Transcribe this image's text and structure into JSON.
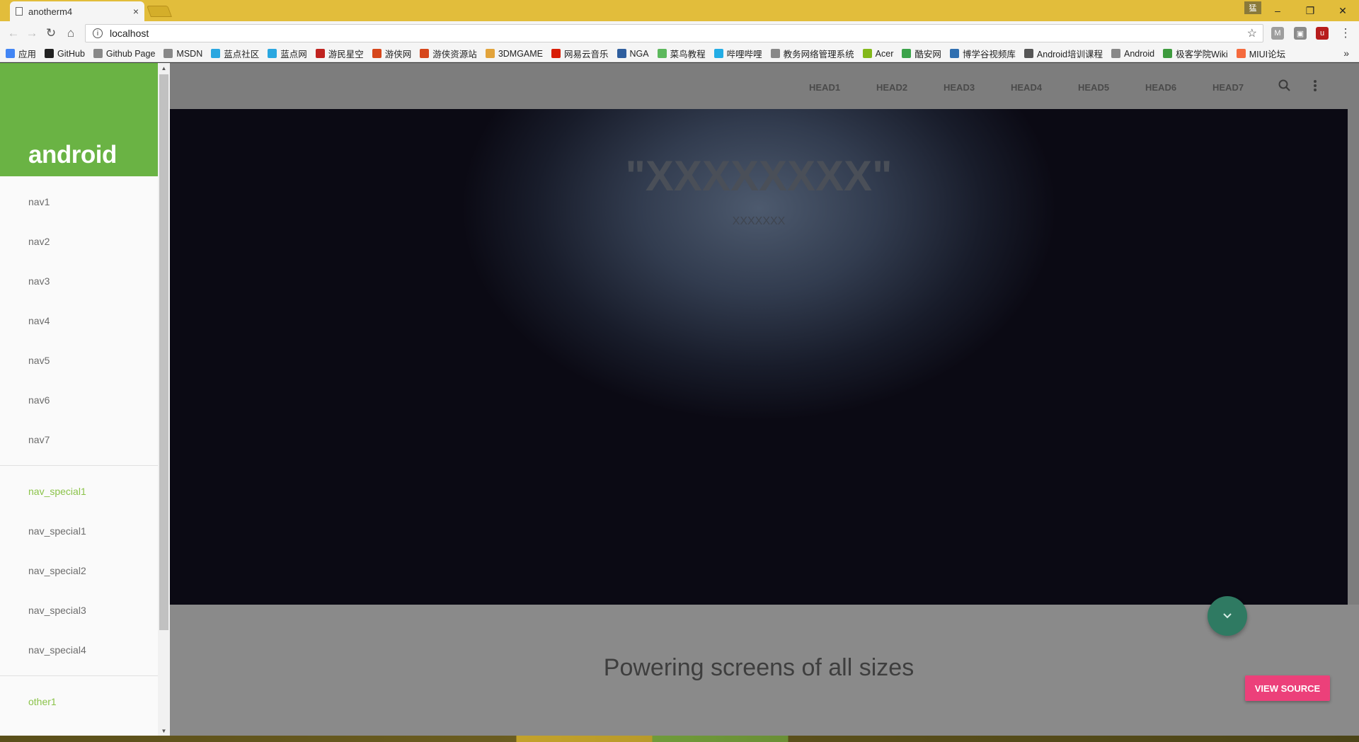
{
  "browser": {
    "tab_title": "anotherm4",
    "tab_close": "×",
    "url": "localhost",
    "profile_badge": "猛",
    "window_buttons": {
      "minimize": "–",
      "restore": "❐",
      "close": "✕"
    },
    "bookmarks_more": "»",
    "bookmarks": [
      {
        "label": "应用",
        "color": "#4285f4"
      },
      {
        "label": "GitHub",
        "color": "#222222"
      },
      {
        "label": "Github Page",
        "color": "#888888"
      },
      {
        "label": "MSDN",
        "color": "#888888"
      },
      {
        "label": "蓝点社区",
        "color": "#2aa7e0"
      },
      {
        "label": "蓝点网",
        "color": "#2aa7e0"
      },
      {
        "label": "游民星空",
        "color": "#c0231f"
      },
      {
        "label": "游侠网",
        "color": "#d6461b"
      },
      {
        "label": "游侠资源站",
        "color": "#d6461b"
      },
      {
        "label": "3DMGAME",
        "color": "#e2a33a"
      },
      {
        "label": "网易云音乐",
        "color": "#d81e06"
      },
      {
        "label": "NGA",
        "color": "#2f5e9e"
      },
      {
        "label": "菜鸟教程",
        "color": "#5cb85c"
      },
      {
        "label": "哔哩哔哩",
        "color": "#23ade5"
      },
      {
        "label": "教务网络管理系统",
        "color": "#888888"
      },
      {
        "label": "Acer",
        "color": "#83b81a"
      },
      {
        "label": "酷安网",
        "color": "#3ba34a"
      },
      {
        "label": "博学谷视频库",
        "color": "#2f6fb0"
      },
      {
        "label": "Android培训课程",
        "color": "#555555"
      },
      {
        "label": "Android",
        "color": "#888888"
      },
      {
        "label": "极客学院Wiki",
        "color": "#3e9b3e"
      },
      {
        "label": "MIUI论坛",
        "color": "#f56a3d"
      }
    ]
  },
  "drawer": {
    "logo": "android",
    "items": [
      {
        "label": "nav1",
        "active": false
      },
      {
        "label": "nav2",
        "active": false
      },
      {
        "label": "nav3",
        "active": false
      },
      {
        "label": "nav4",
        "active": false
      },
      {
        "label": "nav5",
        "active": false
      },
      {
        "label": "nav6",
        "active": false
      },
      {
        "label": "nav7",
        "active": false
      }
    ],
    "special_items": [
      {
        "label": "nav_special1",
        "active": true
      },
      {
        "label": "nav_special1",
        "active": false
      },
      {
        "label": "nav_special2",
        "active": false
      },
      {
        "label": "nav_special3",
        "active": false
      },
      {
        "label": "nav_special4",
        "active": false
      }
    ],
    "other_items": [
      {
        "label": "other1",
        "active": true
      }
    ]
  },
  "appbar": {
    "links": [
      "HEAD1",
      "HEAD2",
      "HEAD3",
      "HEAD4",
      "HEAD5",
      "HEAD6",
      "HEAD7"
    ],
    "search_icon": "search-icon",
    "more_icon": "more-vert-icon"
  },
  "hero": {
    "title": "\"XXXXXXXX\"",
    "subtitle": "XXXXXXX"
  },
  "content": {
    "tagline": "Powering screens of all sizes",
    "view_source": "VIEW SOURCE"
  },
  "colors": {
    "accent_green": "#6ab344",
    "active_nav": "#8bc34a",
    "fab": "#2f7a62",
    "view_source": "#ec407a"
  }
}
